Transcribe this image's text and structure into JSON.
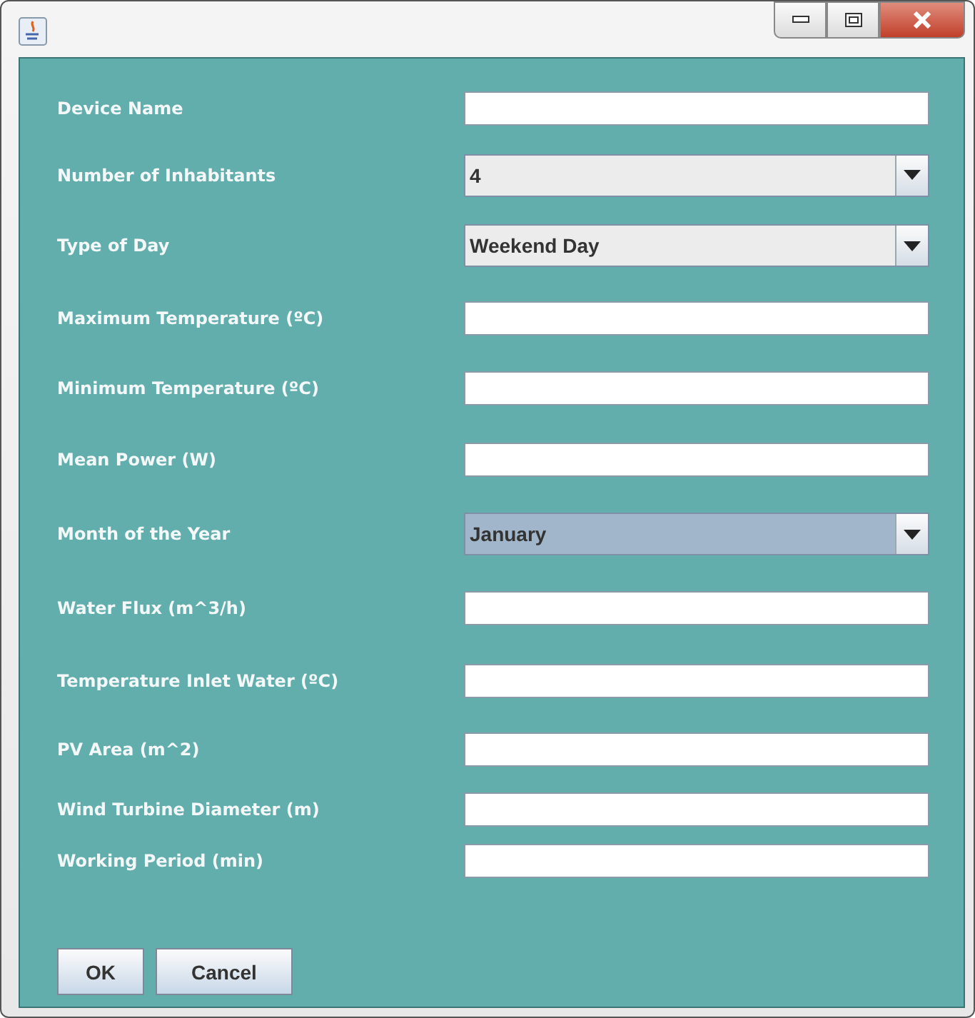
{
  "fields": [
    {
      "label": "Device Name",
      "kind": "text"
    },
    {
      "label": "Number of Inhabitants",
      "kind": "combo",
      "value": "4",
      "focused": false
    },
    {
      "label": "Type of Day",
      "kind": "combo",
      "value": "Weekend Day",
      "focused": false
    },
    {
      "label": "Maximum Temperature (ºC)",
      "kind": "text"
    },
    {
      "label": "Minimum Temperature (ºC)",
      "kind": "text"
    },
    {
      "label": "Mean Power (W)",
      "kind": "text"
    },
    {
      "label": "Month of the Year",
      "kind": "combo",
      "value": "January",
      "focused": true
    },
    {
      "label": "Water Flux (m^3/h)",
      "kind": "text"
    },
    {
      "label": "Temperature Inlet Water (ºC)",
      "kind": "text"
    },
    {
      "label": "PV Area (m^2)",
      "kind": "text"
    },
    {
      "label": "Wind Turbine Diameter (m)",
      "kind": "text"
    },
    {
      "label": "Working Period (min)",
      "kind": "text"
    }
  ],
  "buttons": [
    "OK",
    "Cancel"
  ]
}
